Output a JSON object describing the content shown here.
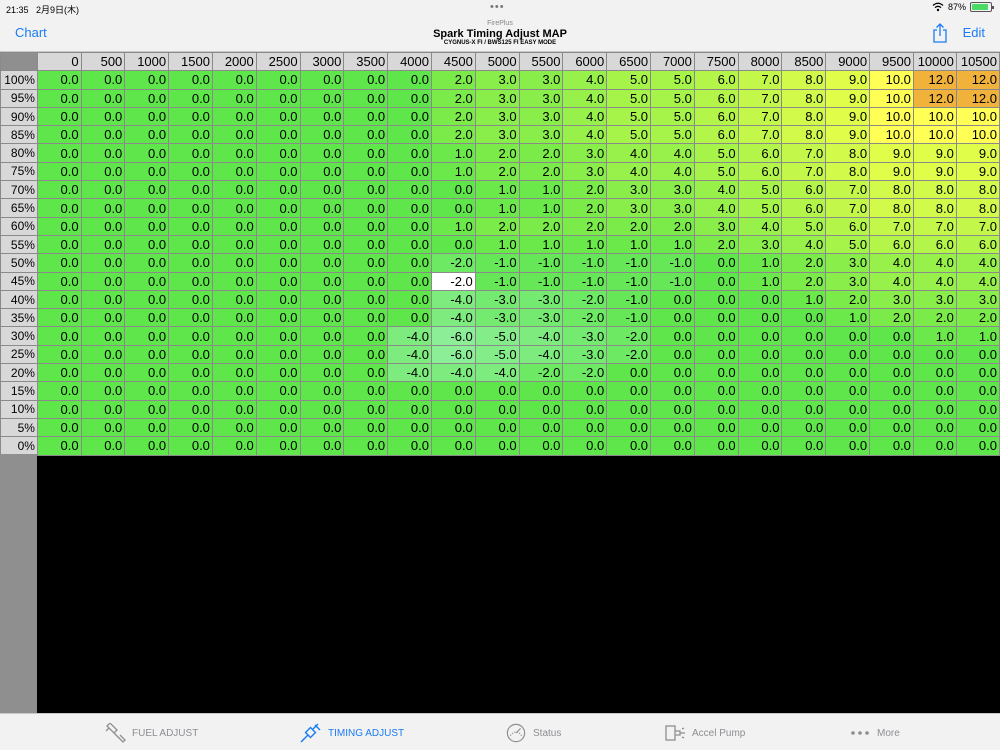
{
  "status": {
    "time": "21:35",
    "date": "2月9日(木)",
    "battery": "87%"
  },
  "nav": {
    "left_label": "Chart",
    "right_label": "Edit",
    "app_name": "FirePlus",
    "title": "Spark Timing Adjust MAP",
    "subtitle": "CYGNUS-X FI / BWS125 FI EASY MODE"
  },
  "map": {
    "rpm": [
      "0",
      "500",
      "1000",
      "1500",
      "2000",
      "2500",
      "3000",
      "3500",
      "4000",
      "4500",
      "5000",
      "5500",
      "6000",
      "6500",
      "7000",
      "7500",
      "8000",
      "8500",
      "9000",
      "9500",
      "10000",
      "10500"
    ],
    "load": [
      "100%",
      "95%",
      "90%",
      "85%",
      "80%",
      "75%",
      "70%",
      "65%",
      "60%",
      "55%",
      "50%",
      "45%",
      "40%",
      "35%",
      "30%",
      "25%",
      "20%",
      "15%",
      "10%",
      "5%",
      "0%"
    ],
    "selected_cell": {
      "row": 11,
      "col": 9
    },
    "values": [
      [
        0,
        0,
        0,
        0,
        0,
        0,
        0,
        0,
        0,
        2,
        3,
        3,
        4,
        5,
        5,
        6,
        7,
        8,
        9,
        10,
        12,
        12
      ],
      [
        0,
        0,
        0,
        0,
        0,
        0,
        0,
        0,
        0,
        2,
        3,
        3,
        4,
        5,
        5,
        6,
        7,
        8,
        9,
        10,
        12,
        12
      ],
      [
        0,
        0,
        0,
        0,
        0,
        0,
        0,
        0,
        0,
        2,
        3,
        3,
        4,
        5,
        5,
        6,
        7,
        8,
        9,
        10,
        10,
        10
      ],
      [
        0,
        0,
        0,
        0,
        0,
        0,
        0,
        0,
        0,
        2,
        3,
        3,
        4,
        5,
        5,
        6,
        7,
        8,
        9,
        10,
        10,
        10
      ],
      [
        0,
        0,
        0,
        0,
        0,
        0,
        0,
        0,
        0,
        1,
        2,
        2,
        3,
        4,
        4,
        5,
        6,
        7,
        8,
        9,
        9,
        9
      ],
      [
        0,
        0,
        0,
        0,
        0,
        0,
        0,
        0,
        0,
        1,
        2,
        2,
        3,
        4,
        4,
        5,
        6,
        7,
        8,
        9,
        9,
        9
      ],
      [
        0,
        0,
        0,
        0,
        0,
        0,
        0,
        0,
        0,
        0,
        1,
        1,
        2,
        3,
        3,
        4,
        5,
        6,
        7,
        8,
        8,
        8
      ],
      [
        0,
        0,
        0,
        0,
        0,
        0,
        0,
        0,
        0,
        0,
        1,
        1,
        2,
        3,
        3,
        4,
        5,
        6,
        7,
        8,
        8,
        8
      ],
      [
        0,
        0,
        0,
        0,
        0,
        0,
        0,
        0,
        0,
        1,
        2,
        2,
        2,
        2,
        2,
        3,
        4,
        5,
        6,
        7,
        7,
        7
      ],
      [
        0,
        0,
        0,
        0,
        0,
        0,
        0,
        0,
        0,
        0,
        1,
        1,
        1,
        1,
        1,
        2,
        3,
        4,
        5,
        6,
        6,
        6
      ],
      [
        0,
        0,
        0,
        0,
        0,
        0,
        0,
        0,
        0,
        -2,
        -1,
        -1,
        -1,
        -1,
        -1,
        0,
        1,
        2,
        3,
        4,
        4,
        4
      ],
      [
        0,
        0,
        0,
        0,
        0,
        0,
        0,
        0,
        0,
        -2,
        -1,
        -1,
        -1,
        -1,
        -1,
        0,
        1,
        2,
        3,
        4,
        4,
        4
      ],
      [
        0,
        0,
        0,
        0,
        0,
        0,
        0,
        0,
        0,
        -4,
        -3,
        -3,
        -2,
        -1,
        0,
        0,
        0,
        1,
        2,
        3,
        3,
        3
      ],
      [
        0,
        0,
        0,
        0,
        0,
        0,
        0,
        0,
        0,
        -4,
        -3,
        -3,
        -2,
        -1,
        0,
        0,
        0,
        0,
        1,
        2,
        2,
        2
      ],
      [
        0,
        0,
        0,
        0,
        0,
        0,
        0,
        0,
        -4,
        -6,
        -5,
        -4,
        -3,
        -2,
        0,
        0,
        0,
        0,
        0,
        0,
        1,
        1
      ],
      [
        0,
        0,
        0,
        0,
        0,
        0,
        0,
        0,
        -4,
        -6,
        -5,
        -4,
        -3,
        -2,
        0,
        0,
        0,
        0,
        0,
        0,
        0,
        0
      ],
      [
        0,
        0,
        0,
        0,
        0,
        0,
        0,
        0,
        -4,
        -4,
        -4,
        -2,
        -2,
        0,
        0,
        0,
        0,
        0,
        0,
        0,
        0,
        0
      ],
      [
        0,
        0,
        0,
        0,
        0,
        0,
        0,
        0,
        0,
        0,
        0,
        0,
        0,
        0,
        0,
        0,
        0,
        0,
        0,
        0,
        0,
        0
      ],
      [
        0,
        0,
        0,
        0,
        0,
        0,
        0,
        0,
        0,
        0,
        0,
        0,
        0,
        0,
        0,
        0,
        0,
        0,
        0,
        0,
        0,
        0
      ],
      [
        0,
        0,
        0,
        0,
        0,
        0,
        0,
        0,
        0,
        0,
        0,
        0,
        0,
        0,
        0,
        0,
        0,
        0,
        0,
        0,
        0,
        0
      ],
      [
        0,
        0,
        0,
        0,
        0,
        0,
        0,
        0,
        0,
        0,
        0,
        0,
        0,
        0,
        0,
        0,
        0,
        0,
        0,
        0,
        0,
        0
      ]
    ]
  },
  "tabs": [
    {
      "label": "FUEL ADJUST",
      "icon": "injector-icon",
      "active": false
    },
    {
      "label": "TIMING ADJUST",
      "icon": "spark-plug-icon",
      "active": true
    },
    {
      "label": "Status",
      "icon": "gauge-icon",
      "active": false
    },
    {
      "label": "Accel Pump",
      "icon": "pump-icon",
      "active": false
    },
    {
      "label": "More",
      "icon": "more-icon",
      "active": false
    }
  ],
  "colors": {
    "accent": "#1a7cf5",
    "zero_green": "#5ee64a",
    "max_orange": "#f0b23a",
    "header_gray": "#d8d8d8"
  }
}
